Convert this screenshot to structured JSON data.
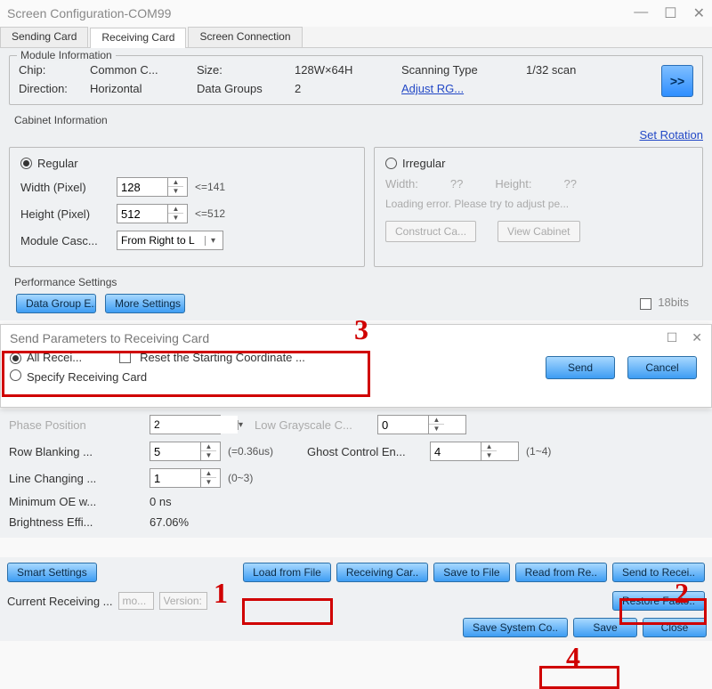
{
  "window": {
    "title": "Screen Configuration-COM99"
  },
  "tabs": {
    "sending": "Sending Card",
    "receiving": "Receiving Card",
    "connection": "Screen Connection"
  },
  "moduleInfo": {
    "title": "Module Information",
    "chipLabel": "Chip:",
    "chipValue": "Common C...",
    "sizeLabel": "Size:",
    "sizeValue": "128W×64H",
    "scanLabel": "Scanning Type",
    "scanValue": "1/32 scan",
    "dirLabel": "Direction:",
    "dirValue": "Horizontal",
    "dgLabel": "Data Groups",
    "dgValue": "2",
    "adjust": "Adjust RG...",
    "arrow": ">>"
  },
  "cabinet": {
    "title": "Cabinet Information",
    "setRotation": "Set Rotation",
    "regular": {
      "label": "Regular",
      "widthLabel": "Width (Pixel)",
      "widthValue": "128",
      "widthHint": "<=141",
      "heightLabel": "Height (Pixel)",
      "heightValue": "512",
      "heightHint": "<=512",
      "cascLabel": "Module Casc...",
      "cascValue": "From Right to L"
    },
    "irregular": {
      "label": "Irregular",
      "widthLabel": "Width:",
      "widthValue": "??",
      "heightLabel": "Height:",
      "heightValue": "??",
      "error": "Loading error. Please try to adjust pe...",
      "construct": "Construct Ca...",
      "view": "View Cabinet"
    }
  },
  "perf": {
    "title": "Performance Settings",
    "btn1": "Data Group E...",
    "btn2": "More Settings",
    "bits": "18bits",
    "phaseLabel": "Phase Position",
    "phaseValue": "2",
    "lowGrayLabel": "Low Grayscale C...",
    "lowGrayValue": "0",
    "rowBlankLabel": "Row Blanking ...",
    "rowBlankValue": "5",
    "rowBlankHint": "(=0.36us)",
    "ghostLabel": "Ghost Control En...",
    "ghostValue": "4",
    "ghostHint": "(1~4)",
    "lineChLabel": "Line Changing ...",
    "lineChValue": "1",
    "lineChHint": "(0~3)",
    "minOELabel": "Minimum OE w...",
    "minOEValue": "0 ns",
    "brightLabel": "Brightness Effi...",
    "brightValue": "67.06%"
  },
  "dialog": {
    "title": "Send Parameters to Receiving Card",
    "allRecv": "All Recei...",
    "reset": "Reset the Starting Coordinate ...",
    "specify": "Specify Receiving Card",
    "send": "Send",
    "cancel": "Cancel"
  },
  "buttons": {
    "smart": "Smart Settings",
    "load": "Load from File",
    "recvCard": "Receiving Car..",
    "saveFile": "Save to File",
    "readRe": "Read from Re..",
    "sendRecv": "Send to Recei..",
    "restore": "Restore Facto..",
    "saveSys": "Save System Co..",
    "save": "Save",
    "close": "Close"
  },
  "status": {
    "label": "Current Receiving ...",
    "mo": "mo...",
    "ver": "Version:"
  },
  "marks": {
    "m1": "1",
    "m2": "2",
    "m3": "3",
    "m4": "4"
  }
}
